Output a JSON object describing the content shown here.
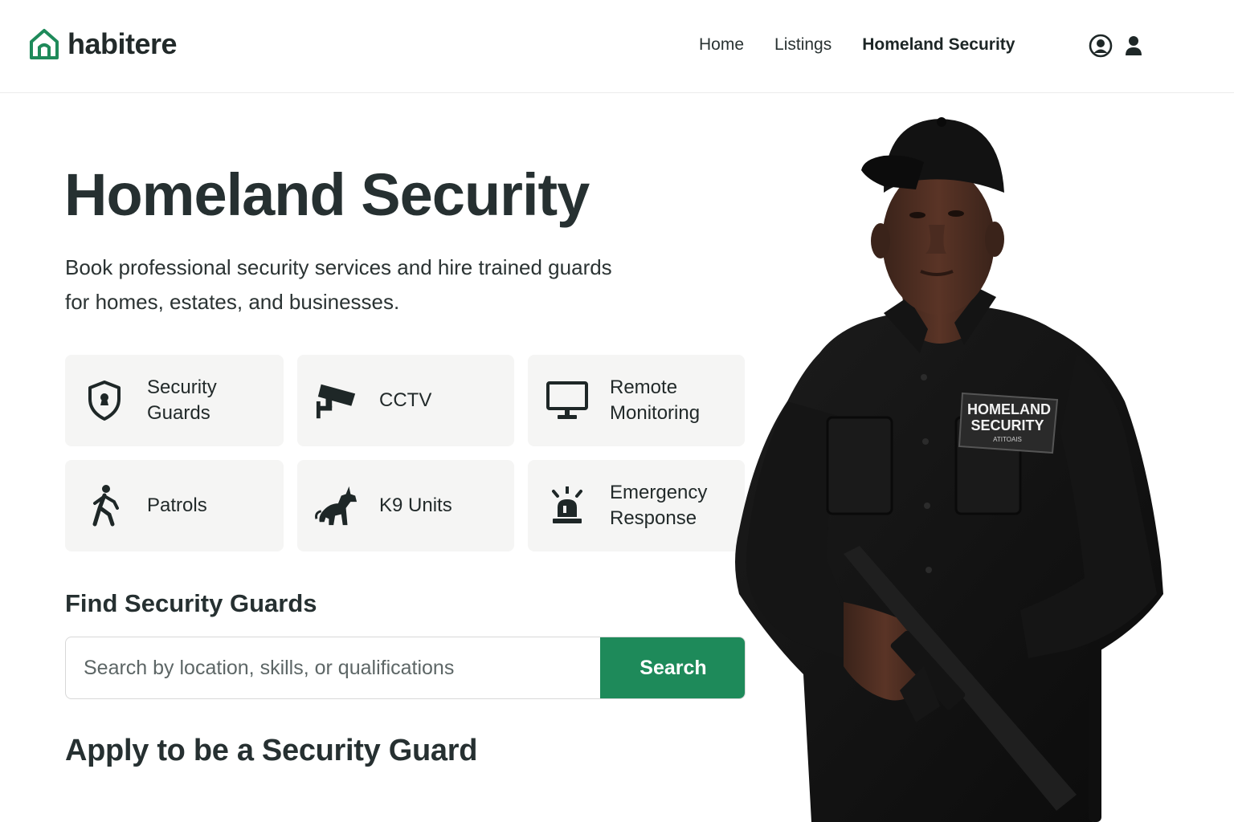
{
  "brand": {
    "name": "habitere",
    "accent": "#1e8a5a"
  },
  "nav": {
    "items": [
      {
        "label": "Home"
      },
      {
        "label": "Listings"
      },
      {
        "label": "Homeland Security"
      }
    ],
    "active": "Homeland Security"
  },
  "header_icons": [
    "account-circle-icon",
    "user-icon"
  ],
  "hero": {
    "title": "Homeland Security",
    "subtitle": "Book professional security services and hire trained guards for homes, estates, and businesses."
  },
  "services": [
    {
      "label": "Security\nGuards",
      "icon": "shield-icon"
    },
    {
      "label": "CCTV",
      "icon": "cctv-camera-icon"
    },
    {
      "label": "Remote\nMonitoring",
      "icon": "monitor-icon"
    },
    {
      "label": "Patrols",
      "icon": "walking-person-icon"
    },
    {
      "label": "K9 Units",
      "icon": "dog-icon"
    },
    {
      "label": "Emergency\nResponse",
      "icon": "siren-icon"
    }
  ],
  "search": {
    "heading": "Find Security Guards",
    "placeholder": "Search by location, skills, or qualifications",
    "button_label": "Search"
  },
  "apply": {
    "heading": "Apply to be a Security Guard"
  },
  "badge": {
    "line1": "HOMELAND",
    "line2": "SECURITY",
    "line3": "ATITOAIS"
  }
}
